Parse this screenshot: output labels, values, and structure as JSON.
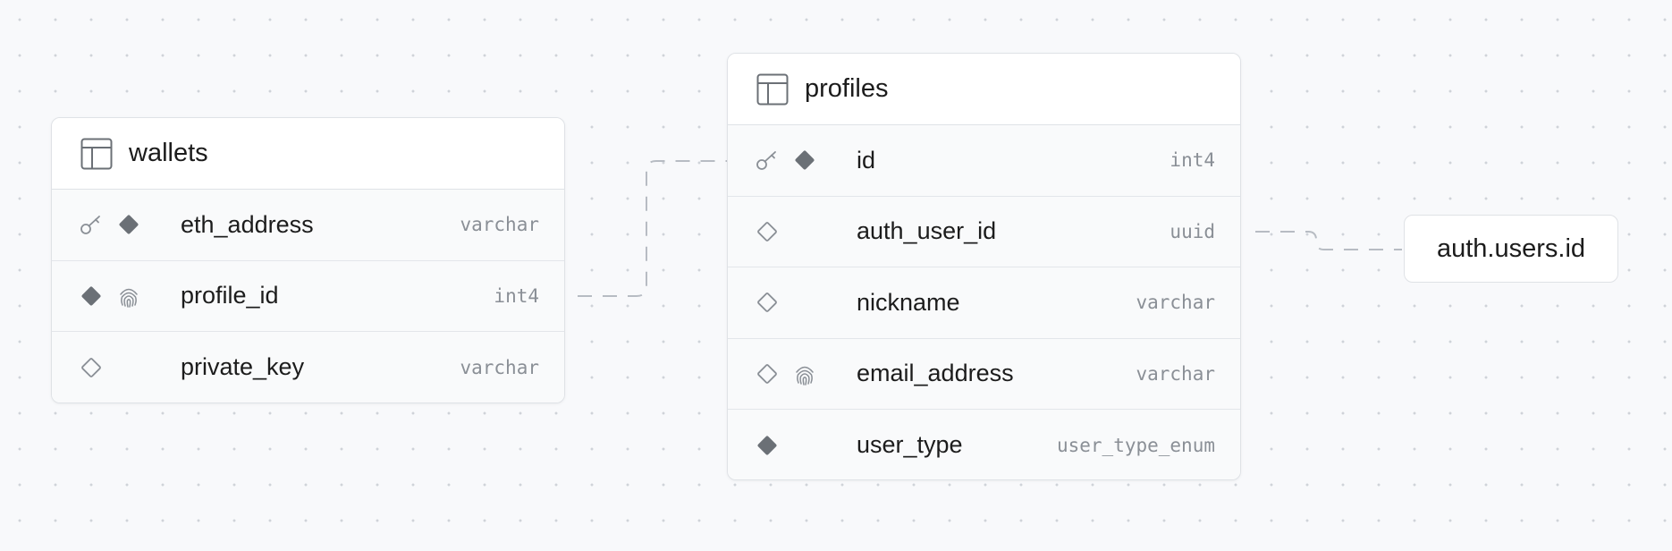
{
  "tables": [
    {
      "name": "wallets",
      "columns": [
        {
          "name": "eth_address",
          "type": "varchar",
          "icons": [
            "key-icon",
            "diamond-filled-icon"
          ]
        },
        {
          "name": "profile_id",
          "type": "int4",
          "icons": [
            "diamond-filled-icon",
            "fingerprint-icon"
          ]
        },
        {
          "name": "private_key",
          "type": "varchar",
          "icons": [
            "diamond-outline-icon"
          ]
        }
      ]
    },
    {
      "name": "profiles",
      "columns": [
        {
          "name": "id",
          "type": "int4",
          "icons": [
            "key-icon",
            "diamond-filled-icon"
          ]
        },
        {
          "name": "auth_user_id",
          "type": "uuid",
          "icons": [
            "diamond-outline-icon"
          ]
        },
        {
          "name": "nickname",
          "type": "varchar",
          "icons": [
            "diamond-outline-icon"
          ]
        },
        {
          "name": "email_address",
          "type": "varchar",
          "icons": [
            "diamond-outline-icon",
            "fingerprint-icon"
          ]
        },
        {
          "name": "user_type",
          "type": "user_type_enum",
          "icons": [
            "diamond-filled-icon"
          ]
        }
      ]
    }
  ],
  "external_reference": {
    "label": "auth.users.id"
  },
  "colors": {
    "icon_fill": "#6b7076",
    "icon_stroke": "#8a8f96",
    "connector": "#b7bcc3",
    "border": "#dfe2e6"
  }
}
